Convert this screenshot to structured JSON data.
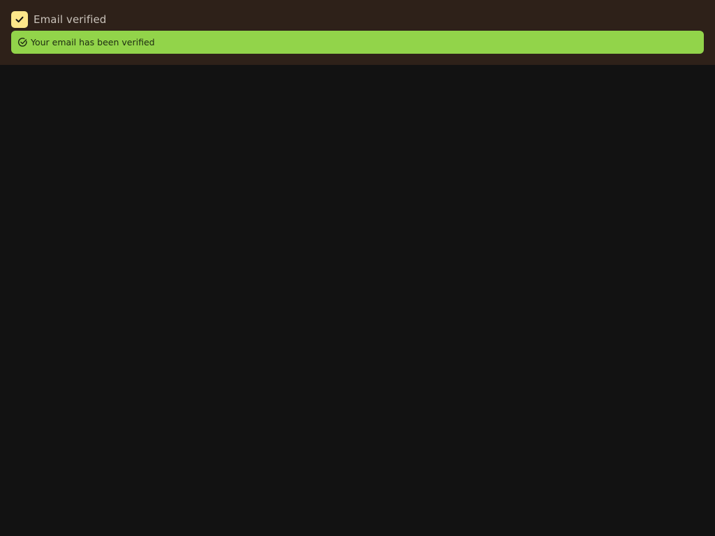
{
  "verification": {
    "checkbox_label": "Email verified",
    "checkbox_checked": true,
    "alert_message": "Your email has been verified"
  },
  "icons": {
    "checkbox": "check-icon",
    "alert": "check-circle-icon"
  },
  "colors": {
    "panel_background": "#2e2119",
    "page_background": "#121212",
    "checkbox_fill": "#fde68a",
    "alert_background": "#92d44a"
  }
}
